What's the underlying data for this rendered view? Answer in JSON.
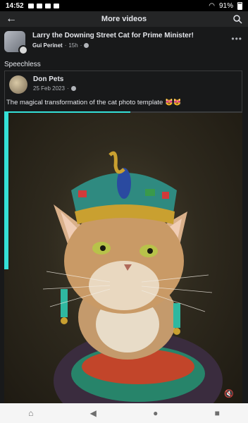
{
  "status_bar": {
    "time": "14:52",
    "battery": "91%"
  },
  "header": {
    "title": "More videos"
  },
  "post": {
    "title": "Larry the Downing Street Cat for Prime Minister!",
    "author": "Gui Perinet",
    "time": "15h",
    "caption": "Speechless"
  },
  "shared": {
    "name": "Don Pets",
    "date": "25 Feb 2023",
    "text": "The magical transformation of the cat photo template 😻😻"
  },
  "video": {
    "progress_fraction": 0.53
  },
  "icons": [
    "back-arrow-icon",
    "search-icon",
    "more-options-icon",
    "globe-icon",
    "mute-icon",
    "home-icon",
    "back-nav-icon",
    "home-nav-icon",
    "recents-icon"
  ]
}
